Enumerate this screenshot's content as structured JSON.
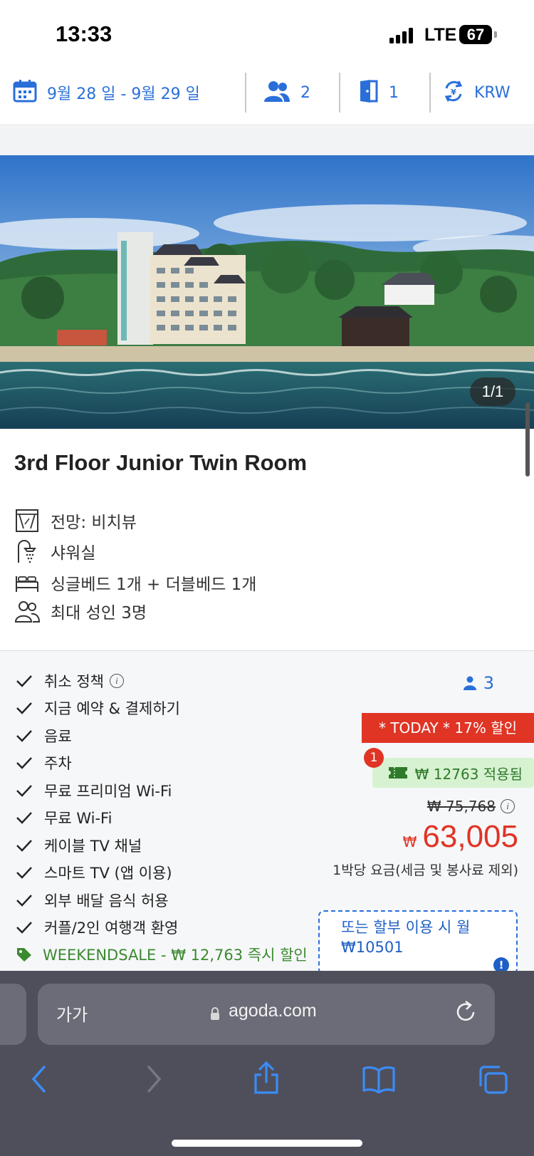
{
  "status_bar": {
    "time": "13:33",
    "network": "LTE",
    "battery": "67"
  },
  "search_bar": {
    "dates": "9월 28 일 - 9월 29 일",
    "guests": "2",
    "rooms": "1",
    "currency": "KRW",
    "icons": [
      "calendar-icon",
      "guests-icon",
      "door-icon",
      "currency-exchange-icon"
    ]
  },
  "hero": {
    "photo_counter": "1/1"
  },
  "room": {
    "title": "3rd Floor Junior Twin Room",
    "features": [
      {
        "icon": "window-view-icon",
        "text": "전망: 비치뷰"
      },
      {
        "icon": "shower-icon",
        "text": "샤워실"
      },
      {
        "icon": "bed-icon",
        "text": "싱글베드 1개 + 더블베드 1개"
      },
      {
        "icon": "people-icon",
        "text": "최대 성인 3명"
      }
    ]
  },
  "benefits": [
    "취소 정책",
    "지금 예약 & 결제하기",
    "음료",
    "주차",
    "무료 프리미엄 Wi-Fi",
    "무료 Wi-Fi",
    "케이블 TV 채널",
    "스마트 TV (앱 이용)",
    "외부 배달 음식 허용",
    "커플/2인 여행객 환영"
  ],
  "promo_text": "WEEKENDSALE - ₩ 12,763 즉시 할인",
  "pricing": {
    "max_guests": "3",
    "deal_badge": "* TODAY * 17% 할인",
    "coupon_count": "1",
    "coupon_text": "₩ 12763 적용됨",
    "original_price": "₩ 75,768",
    "currency_symbol": "₩",
    "price": "63,005",
    "per_night_note": "1박당 요금(세금 및 봉사료 제외)",
    "installment_line1": "또는 할부 이용 시 월",
    "installment_line2": "₩10501"
  },
  "browser": {
    "text_size_label": "가가",
    "url": "agoda.com"
  },
  "colors": {
    "accent_blue": "#2a6fd9",
    "deal_red": "#e03425",
    "coupon_green": "#d7f2d1",
    "promo_green": "#3b8a2f"
  }
}
